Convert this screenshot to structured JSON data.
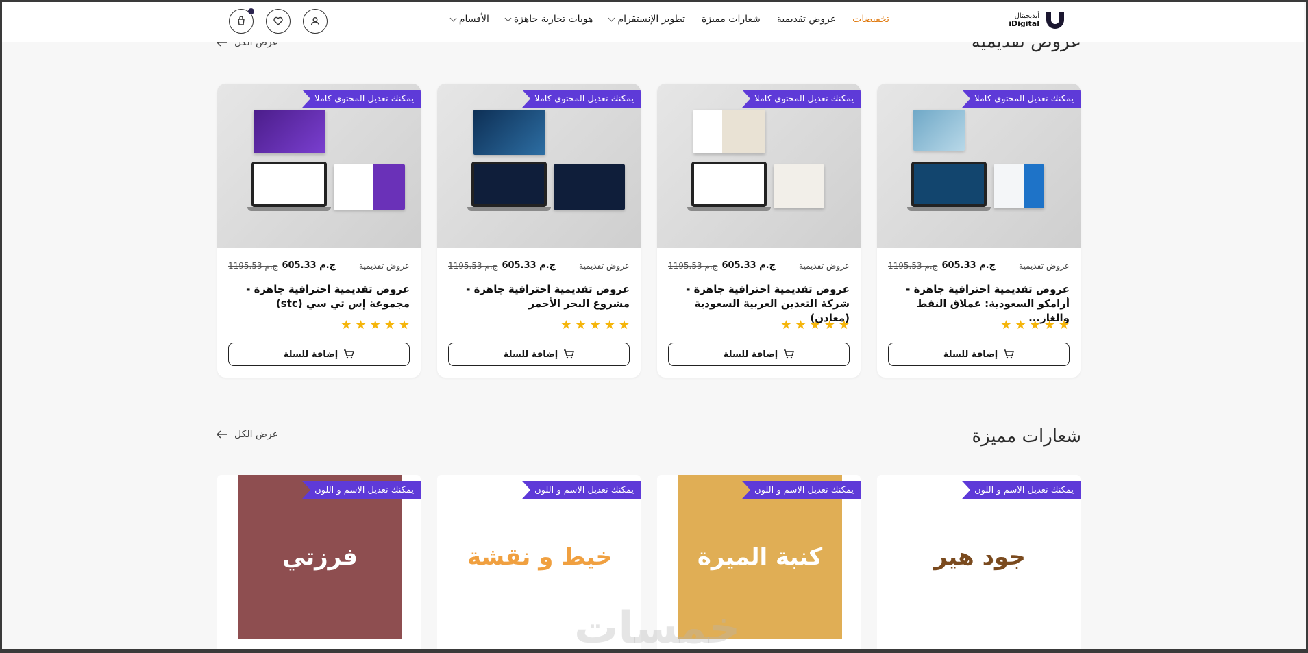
{
  "header": {
    "logo_ar": "أيديجيتال",
    "logo_en": "iDigital",
    "nav": [
      {
        "label": "الأقسام",
        "dropdown": true
      },
      {
        "label": "هويات تجارية جاهزة",
        "dropdown": true
      },
      {
        "label": "تطوير الإنستقرام",
        "dropdown": true
      },
      {
        "label": "شعارات مميزة",
        "dropdown": false
      },
      {
        "label": "عروض تقديمية",
        "dropdown": false
      },
      {
        "label": "تخفيضات",
        "dropdown": false
      }
    ],
    "icons": [
      "user-icon",
      "heart-icon",
      "cart-icon"
    ]
  },
  "presentations": {
    "title": "عروض تقديمية",
    "view_all": "عرض الكل",
    "cards": [
      {
        "ribbon": "يمكنك تعديل المحتوى كاملا",
        "category": "عروض تقديمية",
        "price": "605.33 ج.م",
        "old_price": "1195.53 ج.م",
        "title": "عروض تقديمية احترافية جاهزة - أرامكو السعودية: عملاق النفط والغاز...",
        "rating": 5,
        "button": "إضافة للسلة"
      },
      {
        "ribbon": "يمكنك تعديل المحتوى كاملا",
        "category": "عروض تقديمية",
        "price": "605.33 ج.م",
        "old_price": "1195.53 ج.م",
        "title": "عروض تقديمية احترافية جاهزة - شركة التعدين العربية السعودية (معادن)",
        "rating": 5,
        "button": "إضافة للسلة"
      },
      {
        "ribbon": "يمكنك تعديل المحتوى كاملا",
        "category": "عروض تقديمية",
        "price": "605.33 ج.م",
        "old_price": "1195.53 ج.م",
        "title": "عروض تقديمية احترافية جاهزة - مشروع البحر الأحمر",
        "rating": 5,
        "button": "إضافة للسلة"
      },
      {
        "ribbon": "يمكنك تعديل المحتوى كاملا",
        "category": "عروض تقديمية",
        "price": "605.33 ج.م",
        "old_price": "1195.53 ج.م",
        "title": "عروض تقديمية احترافية جاهزة - مجموعة إس تي سي (stc)",
        "rating": 5,
        "button": "إضافة للسلة"
      }
    ]
  },
  "logos": {
    "title": "شعارات مميزة",
    "view_all": "عرض الكل",
    "cards": [
      {
        "ribbon": "يمكنك تعديل الاسم و اللون",
        "art_text": "جود هير",
        "bg": "#ffffff",
        "fg": "#7a4a1e"
      },
      {
        "ribbon": "يمكنك تعديل الاسم و اللون",
        "art_text": "كنبة الميرة",
        "bg": "#e0ae55",
        "fg": "#ffffff"
      },
      {
        "ribbon": "يمكنك تعديل الاسم و اللون",
        "art_text": "خيط و نقشة",
        "bg": "#ffffff",
        "fg": "#f0a040"
      },
      {
        "ribbon": "يمكنك تعديل الاسم و اللون",
        "art_text": "فرزتي",
        "bg": "#8e4e50",
        "fg": "#ffffff"
      }
    ]
  },
  "colors": {
    "ribbon": "#5e3ad8",
    "star": "#f5b50a",
    "sale": "#e07a10"
  },
  "watermark": "خمسات"
}
